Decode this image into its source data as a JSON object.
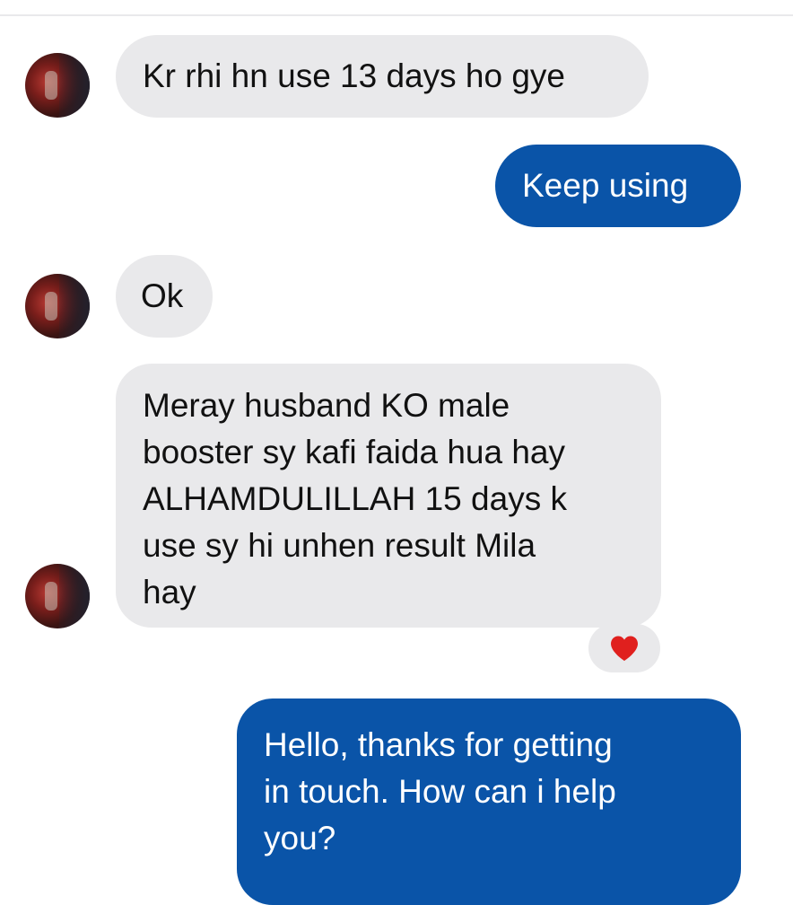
{
  "messages": [
    {
      "sender": "contact",
      "text": "Kr rhi hn use 13 days ho gye"
    },
    {
      "sender": "me",
      "text": "Keep using"
    },
    {
      "sender": "contact",
      "text": "Ok"
    },
    {
      "sender": "contact",
      "text": "Meray husband KO male\nbooster sy kafi faida hua hay\nALHAMDULILLAH 15 days k\nuse sy hi unhen result Mila\nhay"
    },
    {
      "sender": "me",
      "text": "Hello, thanks for getting\nin touch. How can i help\nyou?"
    }
  ],
  "reaction": {
    "icon": "heart-icon",
    "color": "#e0201e"
  },
  "colors": {
    "incoming_bubble": "#e9e9eb",
    "outgoing_bubble": "#0a54a8"
  }
}
